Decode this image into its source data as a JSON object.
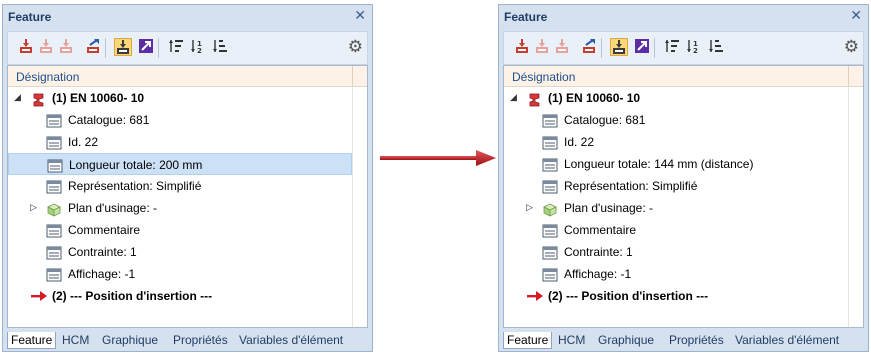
{
  "panels": [
    {
      "title": "Feature",
      "header": "Désignation",
      "rows": [
        {
          "text": "(1) EN 10060- 10",
          "icon": "steel-profile-icon",
          "level": 0,
          "expand": "collapse",
          "bold": true
        },
        {
          "text": "Catalogue: 681",
          "icon": "property-icon",
          "level": 1
        },
        {
          "text": "Id. 22",
          "icon": "property-icon",
          "level": 1
        },
        {
          "text": "Longueur totale: 200 mm",
          "icon": "property-icon",
          "level": 1,
          "selected": true
        },
        {
          "text": "Représentation: Simplifié",
          "icon": "property-icon",
          "level": 1
        },
        {
          "text": "Plan d'usinage: -",
          "icon": "cube-icon",
          "level": 1,
          "expand": "expand"
        },
        {
          "text": "Commentaire",
          "icon": "property-icon",
          "level": 1
        },
        {
          "text": "Contrainte: 1",
          "icon": "property-icon",
          "level": 1
        },
        {
          "text": "Affichage: -1",
          "icon": "property-icon",
          "level": 1
        },
        {
          "text": "(2) --- Position  d'insertion ---",
          "icon": "red-arrow-icon",
          "level": 0,
          "bold": true
        }
      ],
      "tabs": [
        "Feature",
        "HCM",
        "Graphique",
        "Propriétés",
        "Variables d'élément"
      ],
      "active_tab": 0
    },
    {
      "title": "Feature",
      "header": "Désignation",
      "rows": [
        {
          "text": "(1) EN 10060- 10",
          "icon": "steel-profile-icon",
          "level": 0,
          "expand": "collapse",
          "bold": true
        },
        {
          "text": "Catalogue: 681",
          "icon": "property-icon",
          "level": 1
        },
        {
          "text": "Id. 22",
          "icon": "property-icon",
          "level": 1
        },
        {
          "text": "Longueur totale: 144 mm (distance)",
          "icon": "property-icon",
          "level": 1
        },
        {
          "text": "Représentation: Simplifié",
          "icon": "property-icon",
          "level": 1
        },
        {
          "text": "Plan d'usinage: -",
          "icon": "cube-icon",
          "level": 1,
          "expand": "expand"
        },
        {
          "text": "Commentaire",
          "icon": "property-icon",
          "level": 1
        },
        {
          "text": "Contrainte: 1",
          "icon": "property-icon",
          "level": 1
        },
        {
          "text": "Affichage: -1",
          "icon": "property-icon",
          "level": 1
        },
        {
          "text": "(2) --- Position  d'insertion ---",
          "icon": "red-arrow-icon",
          "level": 0,
          "bold": true
        }
      ],
      "tabs": [
        "Feature",
        "HCM",
        "Graphique",
        "Propriétés",
        "Variables d'élément"
      ],
      "active_tab": 0
    }
  ],
  "toolbar_icons": [
    "feature-add-icon",
    "feature-add-disabled-icon",
    "feature-add-disabled-icon",
    "feature-edit-icon",
    "feature-active-icon",
    "arrow-select-icon",
    "sort-up-icon",
    "sort-number-icon",
    "sort-down-icon"
  ],
  "colors": {
    "accent": "#1f4e8c",
    "panel_bg": "#d6e1ef",
    "selection": "#cce0f6",
    "arrow": "#c0161c"
  }
}
